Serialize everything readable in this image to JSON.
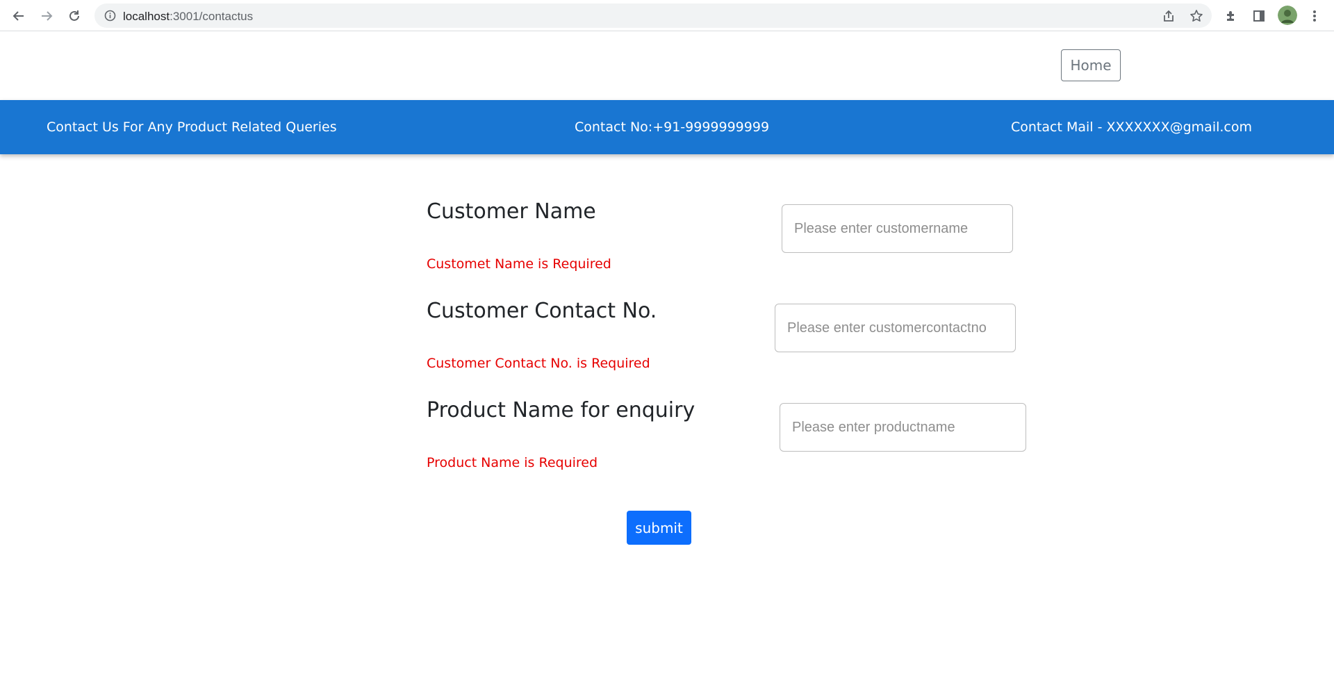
{
  "browser": {
    "url_host": "localhost",
    "url_rest": ":3001/contactus"
  },
  "nav": {
    "home_label": "Home"
  },
  "banner": {
    "tagline": "Contact Us For Any Product Related Queries",
    "contact_no": "Contact No:+91-9999999999",
    "contact_mail": "Contact Mail - XXXXXXX@gmail.com"
  },
  "form": {
    "fields": [
      {
        "label": "Customer Name",
        "placeholder": "Please enter customername",
        "value": "",
        "error": "Customet Name is Required"
      },
      {
        "label": "Customer Contact No.",
        "placeholder": "Please enter customercontactno",
        "value": "",
        "error": "Customer Contact No. is Required"
      },
      {
        "label": "Product Name for enquiry",
        "placeholder": "Please enter productname",
        "value": "",
        "error": "Product Name is Required"
      }
    ],
    "submit_label": "submit"
  },
  "colors": {
    "banner": "#1976d2",
    "error": "#e60000",
    "submit": "#0d6efd"
  }
}
